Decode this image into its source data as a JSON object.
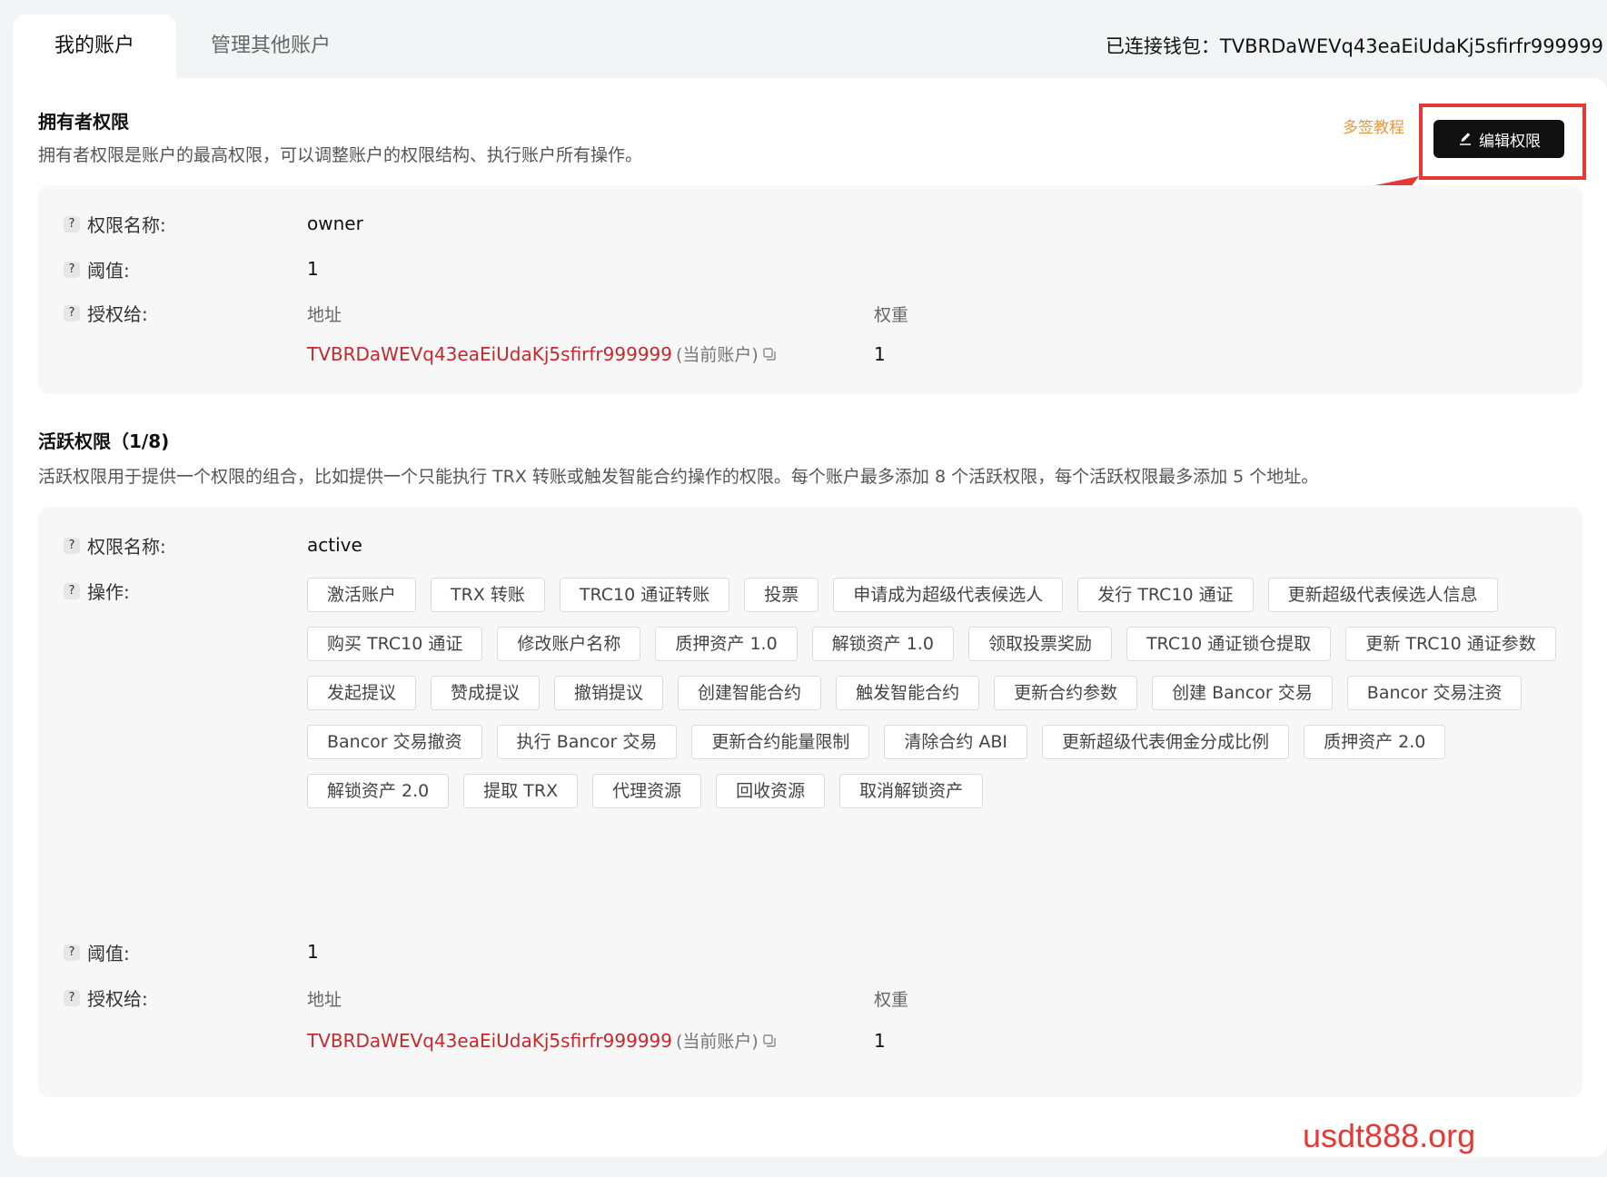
{
  "tabs": {
    "my_account": "我的账户",
    "manage_other": "管理其他账户"
  },
  "wallet": {
    "label": "已连接钱包：",
    "address": "TVBRDaWEVq43eaEiUdaKj5sfirfr999999"
  },
  "owner": {
    "title": "拥有者权限",
    "desc": "拥有者权限是账户的最高权限，可以调整账户的权限结构、执行账户所有操作。",
    "tutorial_link": "多签教程",
    "edit_button": "编辑权限",
    "name_label": "权限名称:",
    "name_value": "owner",
    "threshold_label": "阈值:",
    "threshold_value": "1",
    "grant_label": "授权给:",
    "col_address": "地址",
    "col_weight": "权重",
    "address": "TVBRDaWEVq43eaEiUdaKj5sfirfr999999",
    "address_note": "(当前账户)",
    "weight": "1"
  },
  "active": {
    "title": "活跃权限（1/8)",
    "desc": "活跃权限用于提供一个权限的组合，比如提供一个只能执行 TRX 转账或触发智能合约操作的权限。每个账户最多添加 8 个活跃权限，每个活跃权限最多添加 5 个地址。",
    "name_label": "权限名称:",
    "name_value": "active",
    "ops_label": "操作:",
    "operations": [
      "激活账户",
      "TRX 转账",
      "TRC10 通证转账",
      "投票",
      "申请成为超级代表候选人",
      "发行 TRC10 通证",
      "更新超级代表候选人信息",
      "购买 TRC10 通证",
      "修改账户名称",
      "质押资产 1.0",
      "解锁资产 1.0",
      "领取投票奖励",
      "TRC10 通证锁仓提取",
      "更新 TRC10 通证参数",
      "发起提议",
      "赞成提议",
      "撤销提议",
      "创建智能合约",
      "触发智能合约",
      "更新合约参数",
      "创建 Bancor 交易",
      "Bancor 交易注资",
      "Bancor 交易撤资",
      "执行 Bancor 交易",
      "更新合约能量限制",
      "清除合约 ABI",
      "更新超级代表佣金分成比例",
      "质押资产 2.0",
      "解锁资产 2.0",
      "提取 TRX",
      "代理资源",
      "回收资源",
      "取消解锁资产"
    ],
    "threshold_label": "阈值:",
    "threshold_value": "1",
    "grant_label": "授权给:",
    "col_address": "地址",
    "col_weight": "权重",
    "address": "TVBRDaWEVq43eaEiUdaKj5sfirfr999999",
    "address_note": "(当前账户)",
    "weight": "1"
  },
  "watermark": "usdt888.org",
  "colors": {
    "accent_red": "#e53935",
    "address_red": "#c62828",
    "tutorial_orange": "#e8963a"
  },
  "icons": [
    "question-icon",
    "edit-icon",
    "copy-icon",
    "arrow-annotation"
  ]
}
